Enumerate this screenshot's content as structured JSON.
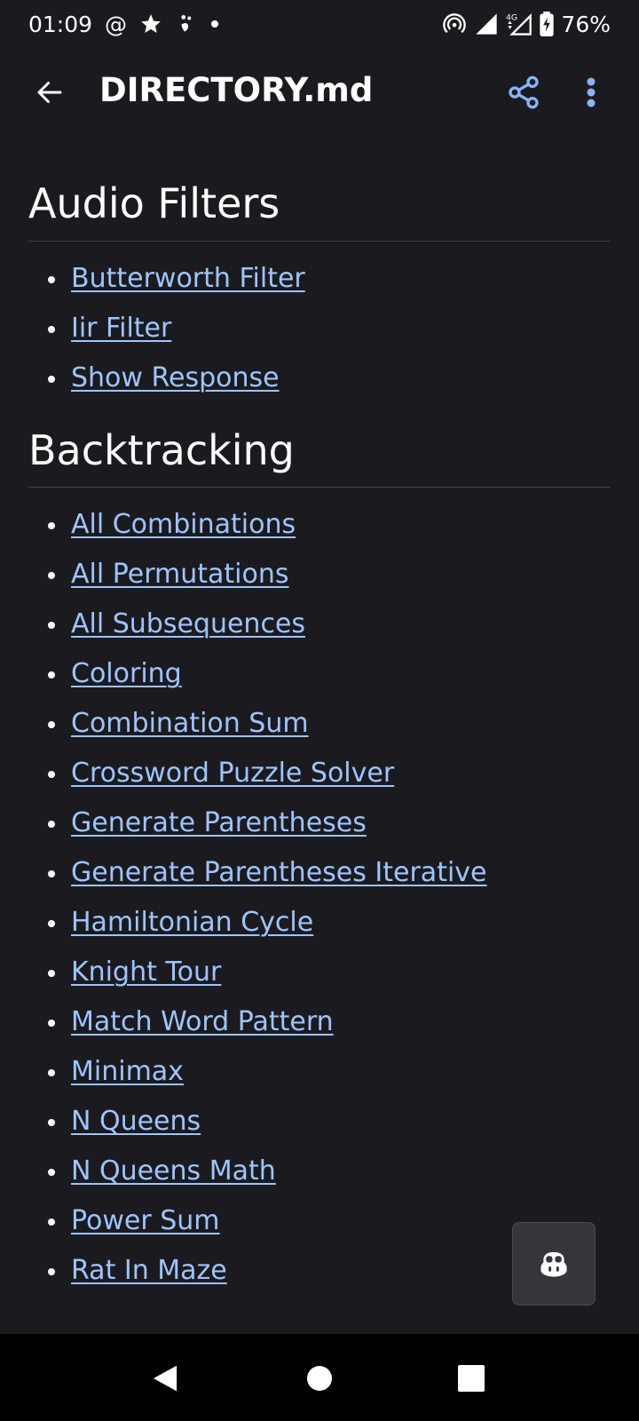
{
  "status_bar": {
    "time": "01:09",
    "battery": "76%",
    "network": "4G"
  },
  "app_bar": {
    "title": "DIRECTORY.md",
    "icons": [
      "back-arrow-icon",
      "share-icon",
      "more-vert-icon"
    ]
  },
  "sections": [
    {
      "heading": "Audio Filters",
      "links": [
        "Butterworth Filter",
        "Iir Filter",
        "Show Response"
      ]
    },
    {
      "heading": "Backtracking",
      "links": [
        "All Combinations",
        "All Permutations",
        "All Subsequences",
        "Coloring",
        "Combination Sum",
        "Crossword Puzzle Solver",
        "Generate Parentheses",
        "Generate Parentheses Iterative",
        "Hamiltonian Cycle",
        "Knight Tour",
        "Match Word Pattern",
        "Minimax",
        "N Queens",
        "N Queens Math",
        "Power Sum",
        "Rat In Maze"
      ]
    }
  ],
  "fab": {
    "icon": "copilot-icon"
  },
  "nav_bar": {
    "icons": [
      "nav-back-icon",
      "nav-home-icon",
      "nav-recents-icon"
    ]
  },
  "colors": {
    "background": "#1b1b1f",
    "link": "#9ec4ff",
    "accent": "#8ab4f8"
  }
}
